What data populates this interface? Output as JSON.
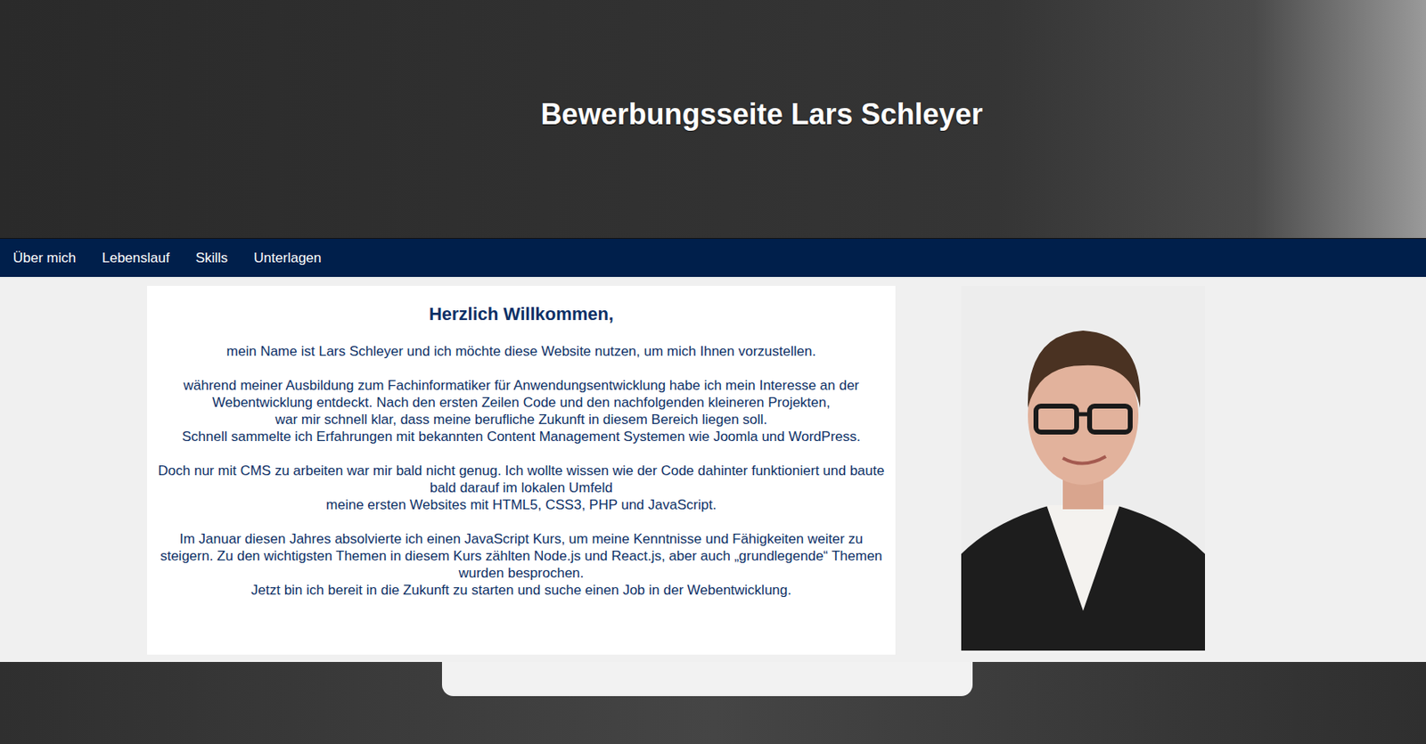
{
  "header": {
    "title": "Bewerbungsseite Lars Schleyer"
  },
  "nav": [
    "Über mich",
    "Lebenslauf",
    "Skills",
    "Unterlagen"
  ],
  "content": {
    "heading": "Herzlich Willkommen,",
    "paragraphs": [
      [
        "mein Name ist Lars Schleyer und ich möchte diese Website nutzen, um mich Ihnen vorzustellen."
      ],
      [
        "während meiner Ausbildung zum Fachinformatiker für Anwendungsentwicklung habe ich mein Interesse an der Webentwicklung entdeckt. Nach den ersten Zeilen Code und den nachfolgenden kleineren Projekten,",
        "war mir schnell klar, dass meine berufliche Zukunft in diesem Bereich liegen soll.",
        "Schnell sammelte ich Erfahrungen mit bekannten Content Management Systemen wie Joomla und WordPress."
      ],
      [
        "Doch nur mit CMS zu arbeiten war mir bald nicht genug. Ich wollte wissen wie der Code dahinter funktioniert und baute bald darauf im lokalen Umfeld",
        "meine ersten Websites mit HTML5, CSS3, PHP und JavaScript."
      ],
      [
        "Im Januar diesen Jahres absolvierte ich einen JavaScript Kurs, um meine Kenntnisse und Fähigkeiten weiter zu steigern. Zu den wichtigsten Themen in diesem Kurs zählten Node.js und React.js, aber auch „grundlegende“ Themen wurden besprochen.",
        "Jetzt bin ich bereit in die Zukunft zu starten und suche einen Job in der Webentwicklung."
      ]
    ]
  }
}
